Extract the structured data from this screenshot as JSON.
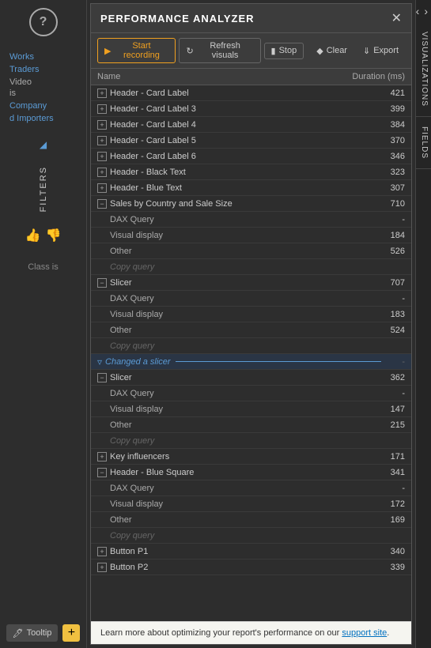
{
  "app": {
    "title": "Performance Analyzer"
  },
  "left_sidebar": {
    "help_icon": "?",
    "nav_items": [
      "Works",
      "Traders",
      "Video",
      "is",
      "Company",
      "d Importers"
    ],
    "filters_label": "FILTERS",
    "class_label": "Class is",
    "tooltip_btn": "Tooltip",
    "add_btn": "+"
  },
  "toolbar": {
    "start_recording": "Start recording",
    "refresh_visuals": "Refresh visuals",
    "stop": "Stop",
    "clear": "Clear",
    "export": "Export"
  },
  "table": {
    "col_name": "Name",
    "col_duration": "Duration (ms)",
    "rows": [
      {
        "level": 0,
        "icon": "plus",
        "name": "Header - Card Label",
        "duration": "421"
      },
      {
        "level": 0,
        "icon": "plus",
        "name": "Header - Card Label 3",
        "duration": "399"
      },
      {
        "level": 0,
        "icon": "plus",
        "name": "Header - Card Label 4",
        "duration": "384"
      },
      {
        "level": 0,
        "icon": "plus",
        "name": "Header - Card Label 5",
        "duration": "370"
      },
      {
        "level": 0,
        "icon": "plus",
        "name": "Header - Card Label 6",
        "duration": "346"
      },
      {
        "level": 0,
        "icon": "plus",
        "name": "Header - Black Text",
        "duration": "323"
      },
      {
        "level": 0,
        "icon": "plus",
        "name": "Header - Blue Text",
        "duration": "307"
      },
      {
        "level": 0,
        "icon": "minus",
        "name": "Sales by Country and Sale Size",
        "duration": "710",
        "expanded": true
      },
      {
        "level": 1,
        "icon": null,
        "name": "DAX Query",
        "duration": "-"
      },
      {
        "level": 1,
        "icon": null,
        "name": "Visual display",
        "duration": "184"
      },
      {
        "level": 1,
        "icon": null,
        "name": "Other",
        "duration": "526"
      },
      {
        "level": 1,
        "icon": null,
        "name": "Copy query",
        "duration": "",
        "copy": true
      },
      {
        "level": 0,
        "icon": "minus",
        "name": "Slicer",
        "duration": "707",
        "expanded": true
      },
      {
        "level": 1,
        "icon": null,
        "name": "DAX Query",
        "duration": "-"
      },
      {
        "level": 1,
        "icon": null,
        "name": "Visual display",
        "duration": "183"
      },
      {
        "level": 1,
        "icon": null,
        "name": "Other",
        "duration": "524"
      },
      {
        "level": 1,
        "icon": null,
        "name": "Copy query",
        "duration": "",
        "copy": true
      },
      {
        "level": -1,
        "icon": "filter",
        "name": "Changed a slicer",
        "duration": "-",
        "type": "changed"
      },
      {
        "level": 0,
        "icon": "minus",
        "name": "Slicer",
        "duration": "362",
        "expanded": true
      },
      {
        "level": 1,
        "icon": null,
        "name": "DAX Query",
        "duration": "-"
      },
      {
        "level": 1,
        "icon": null,
        "name": "Visual display",
        "duration": "147"
      },
      {
        "level": 1,
        "icon": null,
        "name": "Other",
        "duration": "215"
      },
      {
        "level": 1,
        "icon": null,
        "name": "Copy query",
        "duration": "",
        "copy": true
      },
      {
        "level": 0,
        "icon": "plus",
        "name": "Key influencers",
        "duration": "171"
      },
      {
        "level": 0,
        "icon": "minus",
        "name": "Header - Blue Square",
        "duration": "341",
        "expanded": true
      },
      {
        "level": 1,
        "icon": null,
        "name": "DAX Query",
        "duration": "-"
      },
      {
        "level": 1,
        "icon": null,
        "name": "Visual display",
        "duration": "172"
      },
      {
        "level": 1,
        "icon": null,
        "name": "Other",
        "duration": "169"
      },
      {
        "level": 1,
        "icon": null,
        "name": "Copy query",
        "duration": "",
        "copy": true
      },
      {
        "level": 0,
        "icon": "plus",
        "name": "Button P1",
        "duration": "340"
      },
      {
        "level": 0,
        "icon": "plus",
        "name": "Button P2",
        "duration": "339"
      }
    ]
  },
  "footer": {
    "text": "Learn more about optimizing your report's performance on our",
    "link_text": "support site",
    "link_suffix": "."
  },
  "right_tabs": [
    {
      "label": "VISUALIZATIONS"
    },
    {
      "label": "FIELDS"
    }
  ]
}
